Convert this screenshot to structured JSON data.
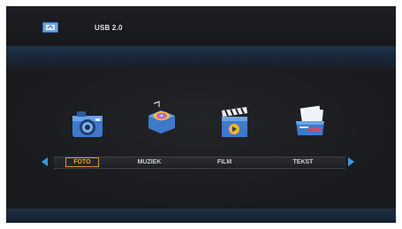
{
  "header": {
    "source_icon": "usb-drive-icon",
    "source_label": "USB 2.0"
  },
  "menu": {
    "items": [
      {
        "label": "FOTO",
        "icon": "camera-icon",
        "selected": true
      },
      {
        "label": "MUZIEK",
        "icon": "music-disc-icon",
        "selected": false
      },
      {
        "label": "FILM",
        "icon": "film-clapper-icon",
        "selected": false
      },
      {
        "label": "TEKST",
        "icon": "document-folder-icon",
        "selected": false
      }
    ],
    "nav_left_icon": "arrow-left-icon",
    "nav_right_icon": "arrow-right-icon"
  },
  "colors": {
    "accent_selected": "#f2a21b",
    "arrow": "#3d9be9",
    "band": "#1f3348",
    "background": "#1b1d22"
  }
}
